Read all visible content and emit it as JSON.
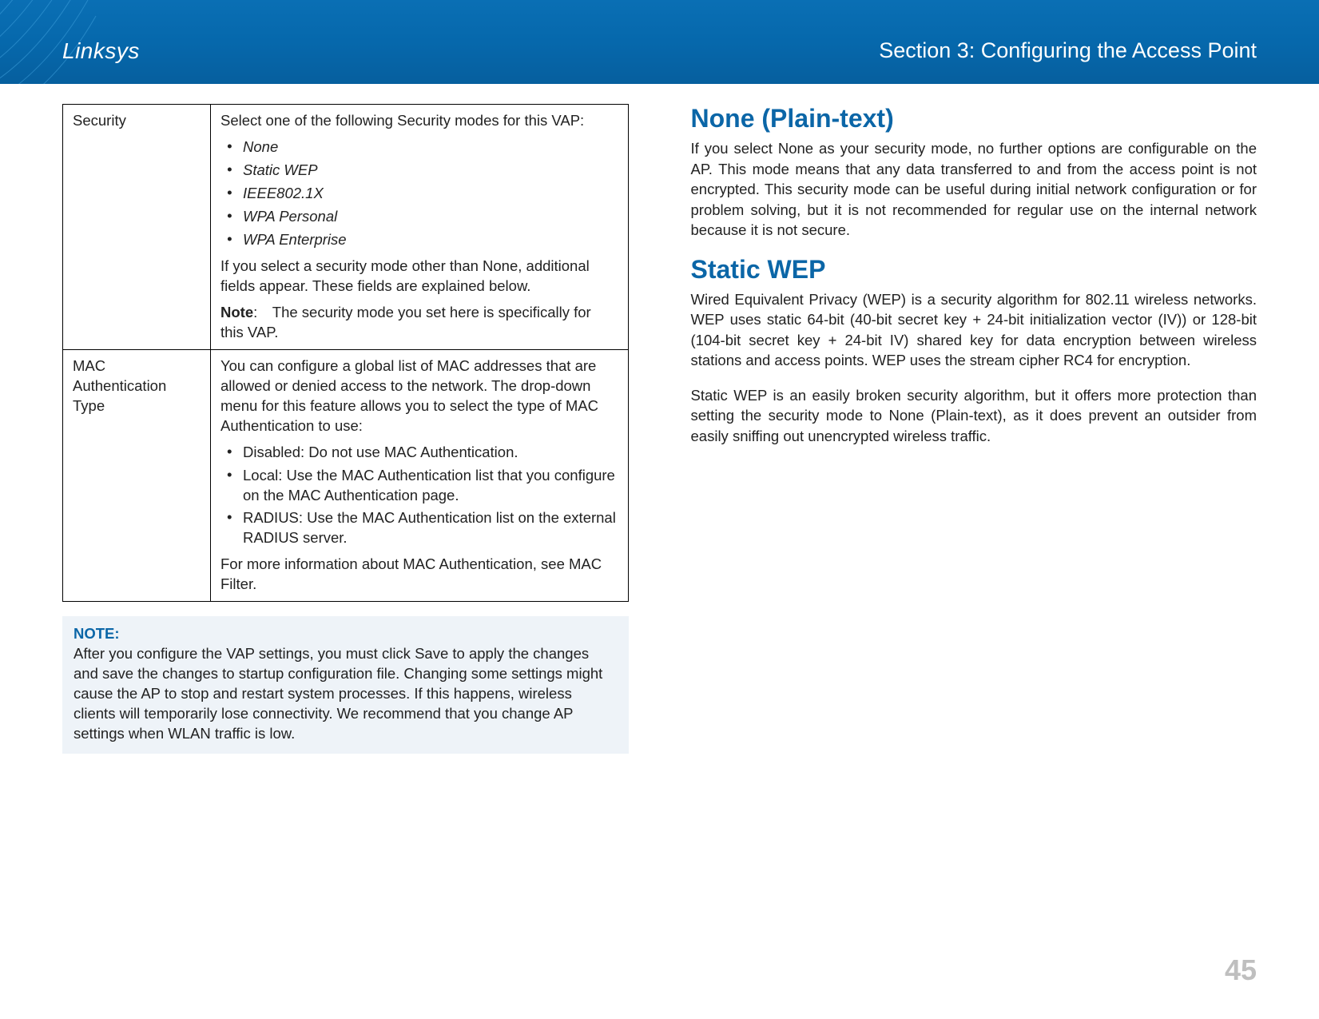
{
  "header": {
    "brand": "Linksys",
    "section": "Section 3:  Configuring the Access Point"
  },
  "table": {
    "security": {
      "label": "Security",
      "intro": "Select one of the following Security modes for this VAP:",
      "modes": [
        "None",
        "Static WEP",
        "IEEE802.1X",
        "WPA Personal",
        "WPA Enterprise"
      ],
      "after": "If you select a security mode other than None, additional fields appear. These fields are explained below.",
      "note_label": "Note",
      "note_text": ": The security mode you set here is specifically for this VAP."
    },
    "mac": {
      "label": "MAC Authentication Type",
      "intro": "You can configure a global list of MAC addresses that are allowed or denied access to the network. The drop-down menu for this feature allows you to select the type of MAC Authentication to use:",
      "opts": [
        "Disabled: Do not use MAC Authentication.",
        "Local: Use the MAC Authentication list that you configure on the MAC Authentication page.",
        "RADIUS: Use the MAC Authentication list on the external RADIUS server."
      ],
      "after": "For more information about MAC Authentication, see MAC Filter."
    }
  },
  "note_block": {
    "hd": "NOTE:",
    "body": "After you configure the VAP settings, you must click Save to apply the changes and save the changes to startup configuration file. Changing some settings might cause the AP to stop and restart system processes. If this happens, wireless clients will temporarily lose connectivity. We recommend that you change AP settings when WLAN traffic is low."
  },
  "right": {
    "h_none": "None (Plain-text)",
    "p_none": "If you select None as your security mode, no further options are configurable on the AP. This mode means that any data transferred to and from the access point is not encrypted. This security mode can be useful during initial network configuration or for problem solving, but it is not recommended for regular use on the internal network because it is not secure.",
    "h_wep": "Static WEP",
    "p_wep1": "Wired Equivalent Privacy (WEP) is a security algorithm for 802.11 wireless networks. WEP uses static 64-bit (40-bit secret key + 24-bit initialization vector (IV)) or 128-bit (104-bit secret key + 24-bit IV) shared key for data encryption between wireless stations and access points. WEP uses the stream cipher RC4 for encryption.",
    "p_wep2": "Static WEP is an easily broken security algorithm, but it offers more protection than setting the security mode to None (Plain-text), as it does prevent an outsider from easily sniffing out unencrypted wireless traffic."
  },
  "page_number": "45"
}
